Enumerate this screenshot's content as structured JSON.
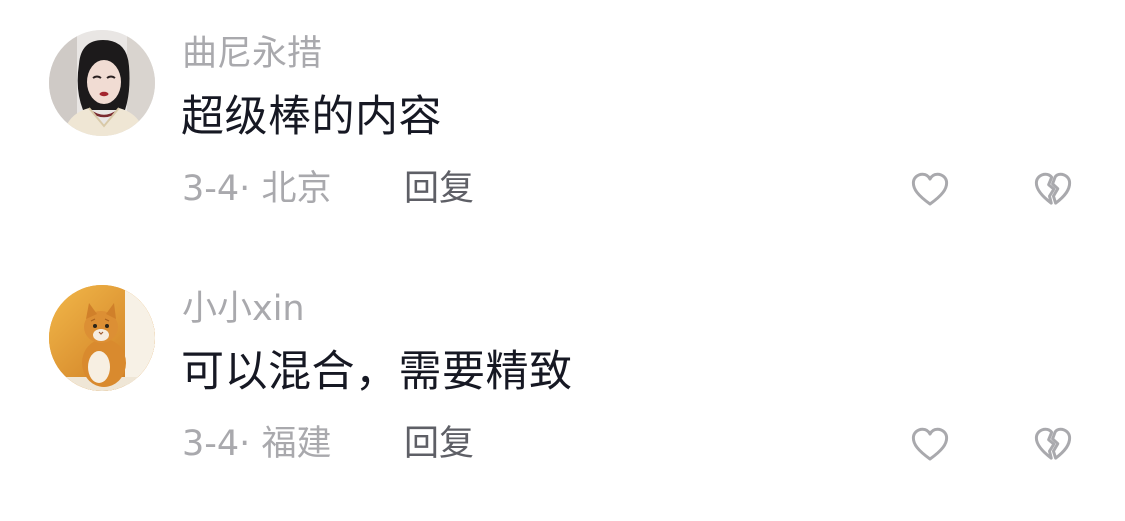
{
  "comments": [
    {
      "username": "曲尼永措",
      "content": "超级棒的内容",
      "date": "3-4",
      "separator": "·",
      "location": "北京",
      "reply_label": "回复",
      "avatar": "woman-portrait-avatar"
    },
    {
      "username": "小小xin",
      "content": "可以混合，需要精致",
      "date": "3-4",
      "separator": "·",
      "location": "福建",
      "reply_label": "回复",
      "avatar": "orange-cat-avatar"
    }
  ],
  "icons": {
    "like": "heart-outline-icon",
    "dislike": "broken-heart-icon"
  },
  "colors": {
    "text_primary": "#161823",
    "text_secondary": "#a9a9ad",
    "reply_text": "#5e5f66",
    "icon_stroke": "#a9a9ad",
    "background": "#ffffff"
  }
}
